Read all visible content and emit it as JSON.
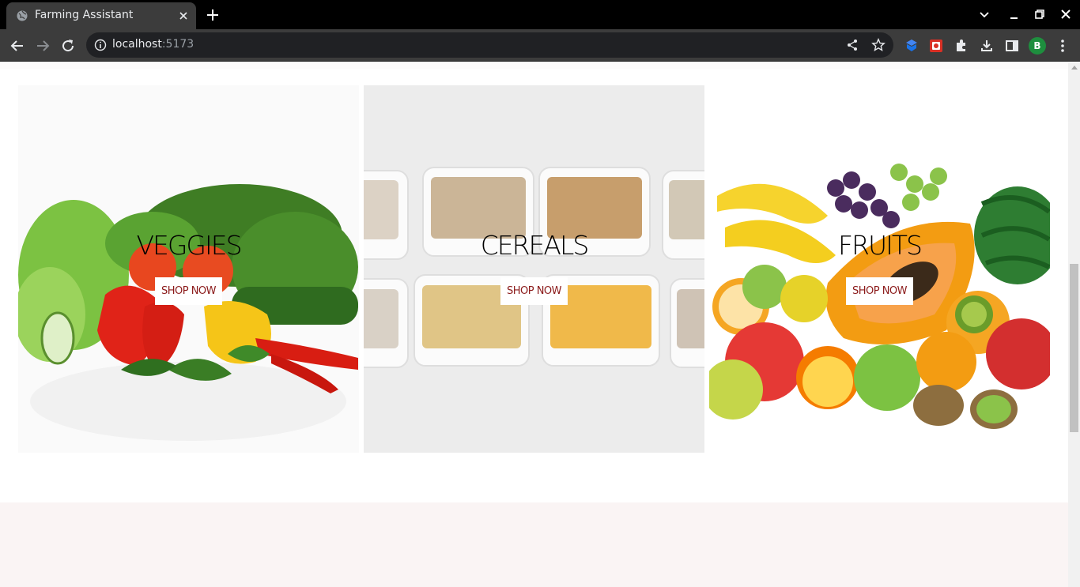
{
  "browser": {
    "tab_title": "Farming Assistant",
    "url_host": "localhost",
    "url_port": ":5173",
    "profile_initial": "B",
    "icons": [
      "globe-icon",
      "close-icon",
      "plus-icon",
      "chevron-down-icon",
      "minimize-icon",
      "restore-icon",
      "window-close-icon",
      "back-icon",
      "forward-icon",
      "reload-icon",
      "info-icon",
      "share-icon",
      "star-icon",
      "extension-shield-icon",
      "extension-red-icon",
      "puzzle-icon",
      "download-icon",
      "side-panel-icon",
      "kebab-menu-icon"
    ]
  },
  "categories": [
    {
      "title": "VEGGIES",
      "button": "SHOP NOW"
    },
    {
      "title": "CEREALS",
      "button": "SHOP NOW"
    },
    {
      "title": "FRUITS",
      "button": "SHOP NOW"
    }
  ],
  "colors": {
    "button_text": "#8b1a1a",
    "footer_bg": "#faf4f4",
    "avatar": "#1e8e3e"
  }
}
